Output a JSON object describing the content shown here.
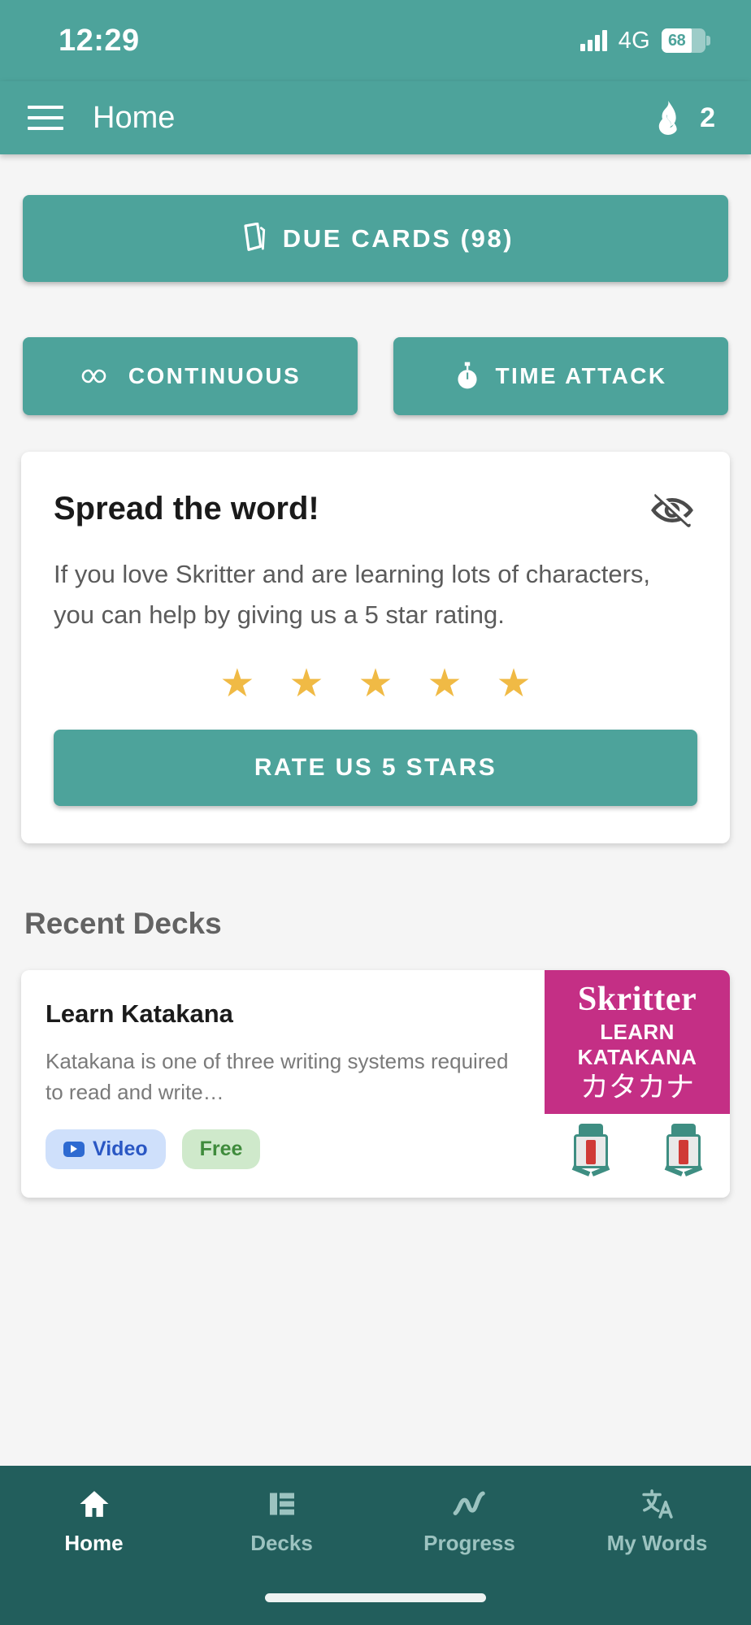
{
  "status_bar": {
    "time": "12:29",
    "network": "4G",
    "battery_percent": "68",
    "signal_icon": "signal-bars-icon",
    "battery_icon": "battery-icon"
  },
  "app_bar": {
    "menu_icon": "hamburger-menu-icon",
    "title": "Home",
    "streak_icon": "flame-icon",
    "streak_count": "2"
  },
  "study": {
    "due_cards_icon": "cards-icon",
    "due_cards_label": "DUE CARDS (98)",
    "due_cards_count": "98",
    "continuous_icon": "infinity-icon",
    "continuous_label": "CONTINUOUS",
    "time_attack_icon": "stopwatch-icon",
    "time_attack_label": "TIME ATTACK"
  },
  "promo": {
    "title": "Spread the word!",
    "hide_icon": "eye-off-icon",
    "body": "If you love Skritter and are learning lots of characters, you can help by giving us a 5 star rating.",
    "stars": [
      "★",
      "★",
      "★",
      "★",
      "★"
    ],
    "star_color": "#F0BA45",
    "rate_button_label": "RATE US 5 STARS"
  },
  "recent_decks": {
    "section_title": "Recent Decks",
    "decks": [
      {
        "name": "Learn Katakana",
        "description": "Katakana is one of three writing systems required to read and write…",
        "chips": [
          {
            "label": "Video",
            "icon": "video-icon"
          },
          {
            "label": "Free",
            "icon": ""
          }
        ],
        "banner": {
          "brand": "Skritter",
          "subtitle": "LEARN KATAKANA",
          "kana": "カタカナ",
          "color": "#C42F85"
        }
      }
    ]
  },
  "bottom_nav": {
    "items": [
      {
        "label": "Home",
        "icon": "home-icon",
        "active": true
      },
      {
        "label": "Decks",
        "icon": "list-icon",
        "active": false
      },
      {
        "label": "Progress",
        "icon": "chart-line-icon",
        "active": false
      },
      {
        "label": "My Words",
        "icon": "translate-icon",
        "active": false
      }
    ]
  },
  "theme": {
    "primary": "#4DA39B",
    "nav_bg": "#225E5C",
    "page_bg": "#F5F5F5"
  }
}
